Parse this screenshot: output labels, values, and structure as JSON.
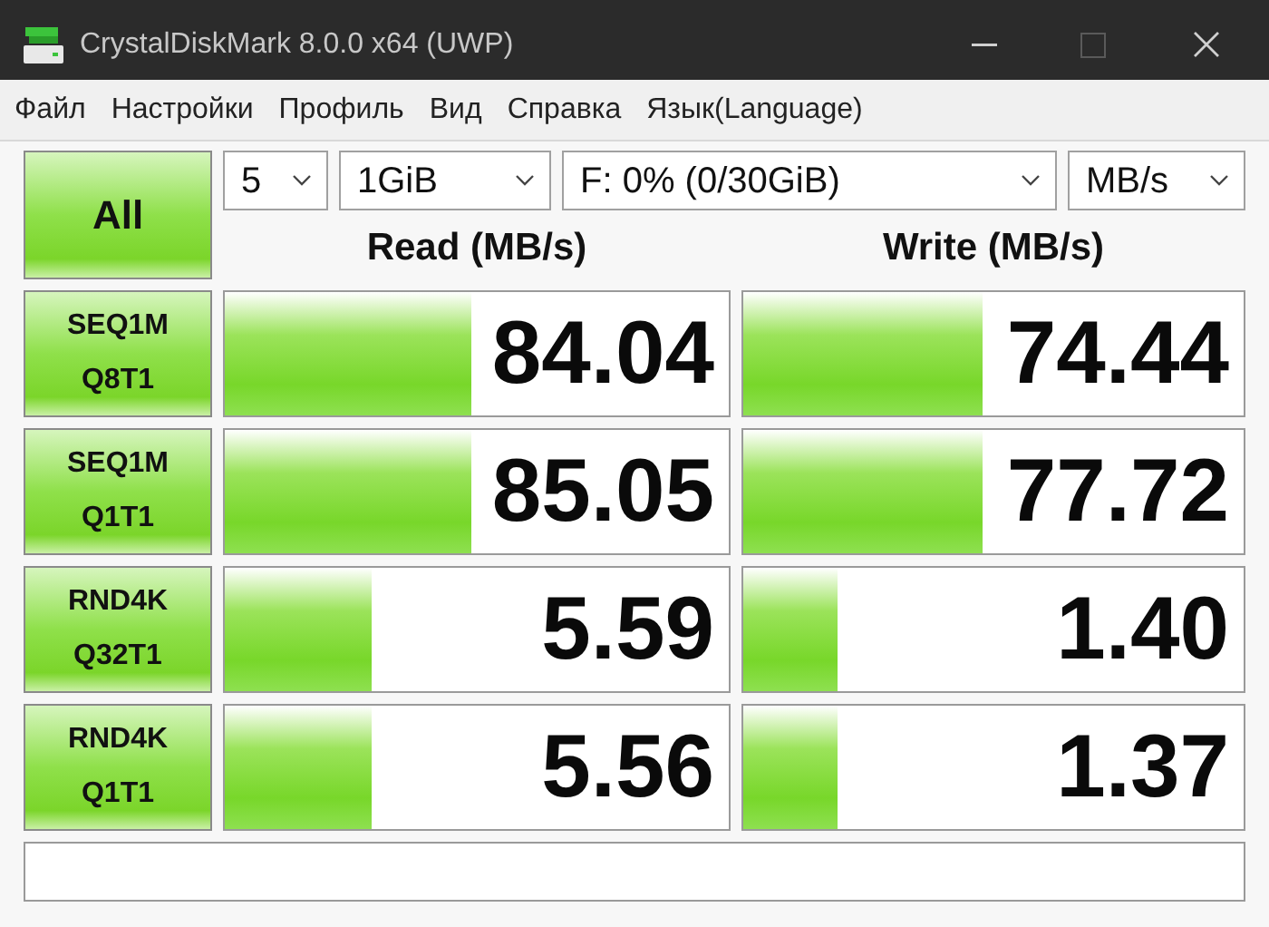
{
  "window": {
    "title": "CrystalDiskMark 8.0.0 x64 (UWP)",
    "maximize_disabled": true
  },
  "menu": [
    "Файл",
    "Настройки",
    "Профиль",
    "Вид",
    "Справка",
    "Язык(Language)"
  ],
  "all_button": "All",
  "selects": [
    {
      "value": "5"
    },
    {
      "value": "1GiB"
    },
    {
      "value": "F: 0% (0/30GiB)"
    },
    {
      "value": "MB/s"
    }
  ],
  "headers": {
    "read": "Read (MB/s)",
    "write": "Write (MB/s)"
  },
  "rows": [
    {
      "name": "SEQ1M",
      "params": "Q8T1",
      "read": {
        "value": "84.04",
        "level": 0.49
      },
      "write": {
        "value": "74.44",
        "level": 0.48
      }
    },
    {
      "name": "SEQ1M",
      "params": "Q1T1",
      "read": {
        "value": "85.05",
        "level": 0.49
      },
      "write": {
        "value": "77.72",
        "level": 0.48
      }
    },
    {
      "name": "RND4K",
      "params": "Q32T1",
      "read": {
        "value": "5.59",
        "level": 0.29
      },
      "write": {
        "value": "1.40",
        "level": 0.19
      }
    },
    {
      "name": "RND4K",
      "params": "Q1T1",
      "read": {
        "value": "5.56",
        "level": 0.29
      },
      "write": {
        "value": "1.37",
        "level": 0.19
      }
    }
  ]
}
